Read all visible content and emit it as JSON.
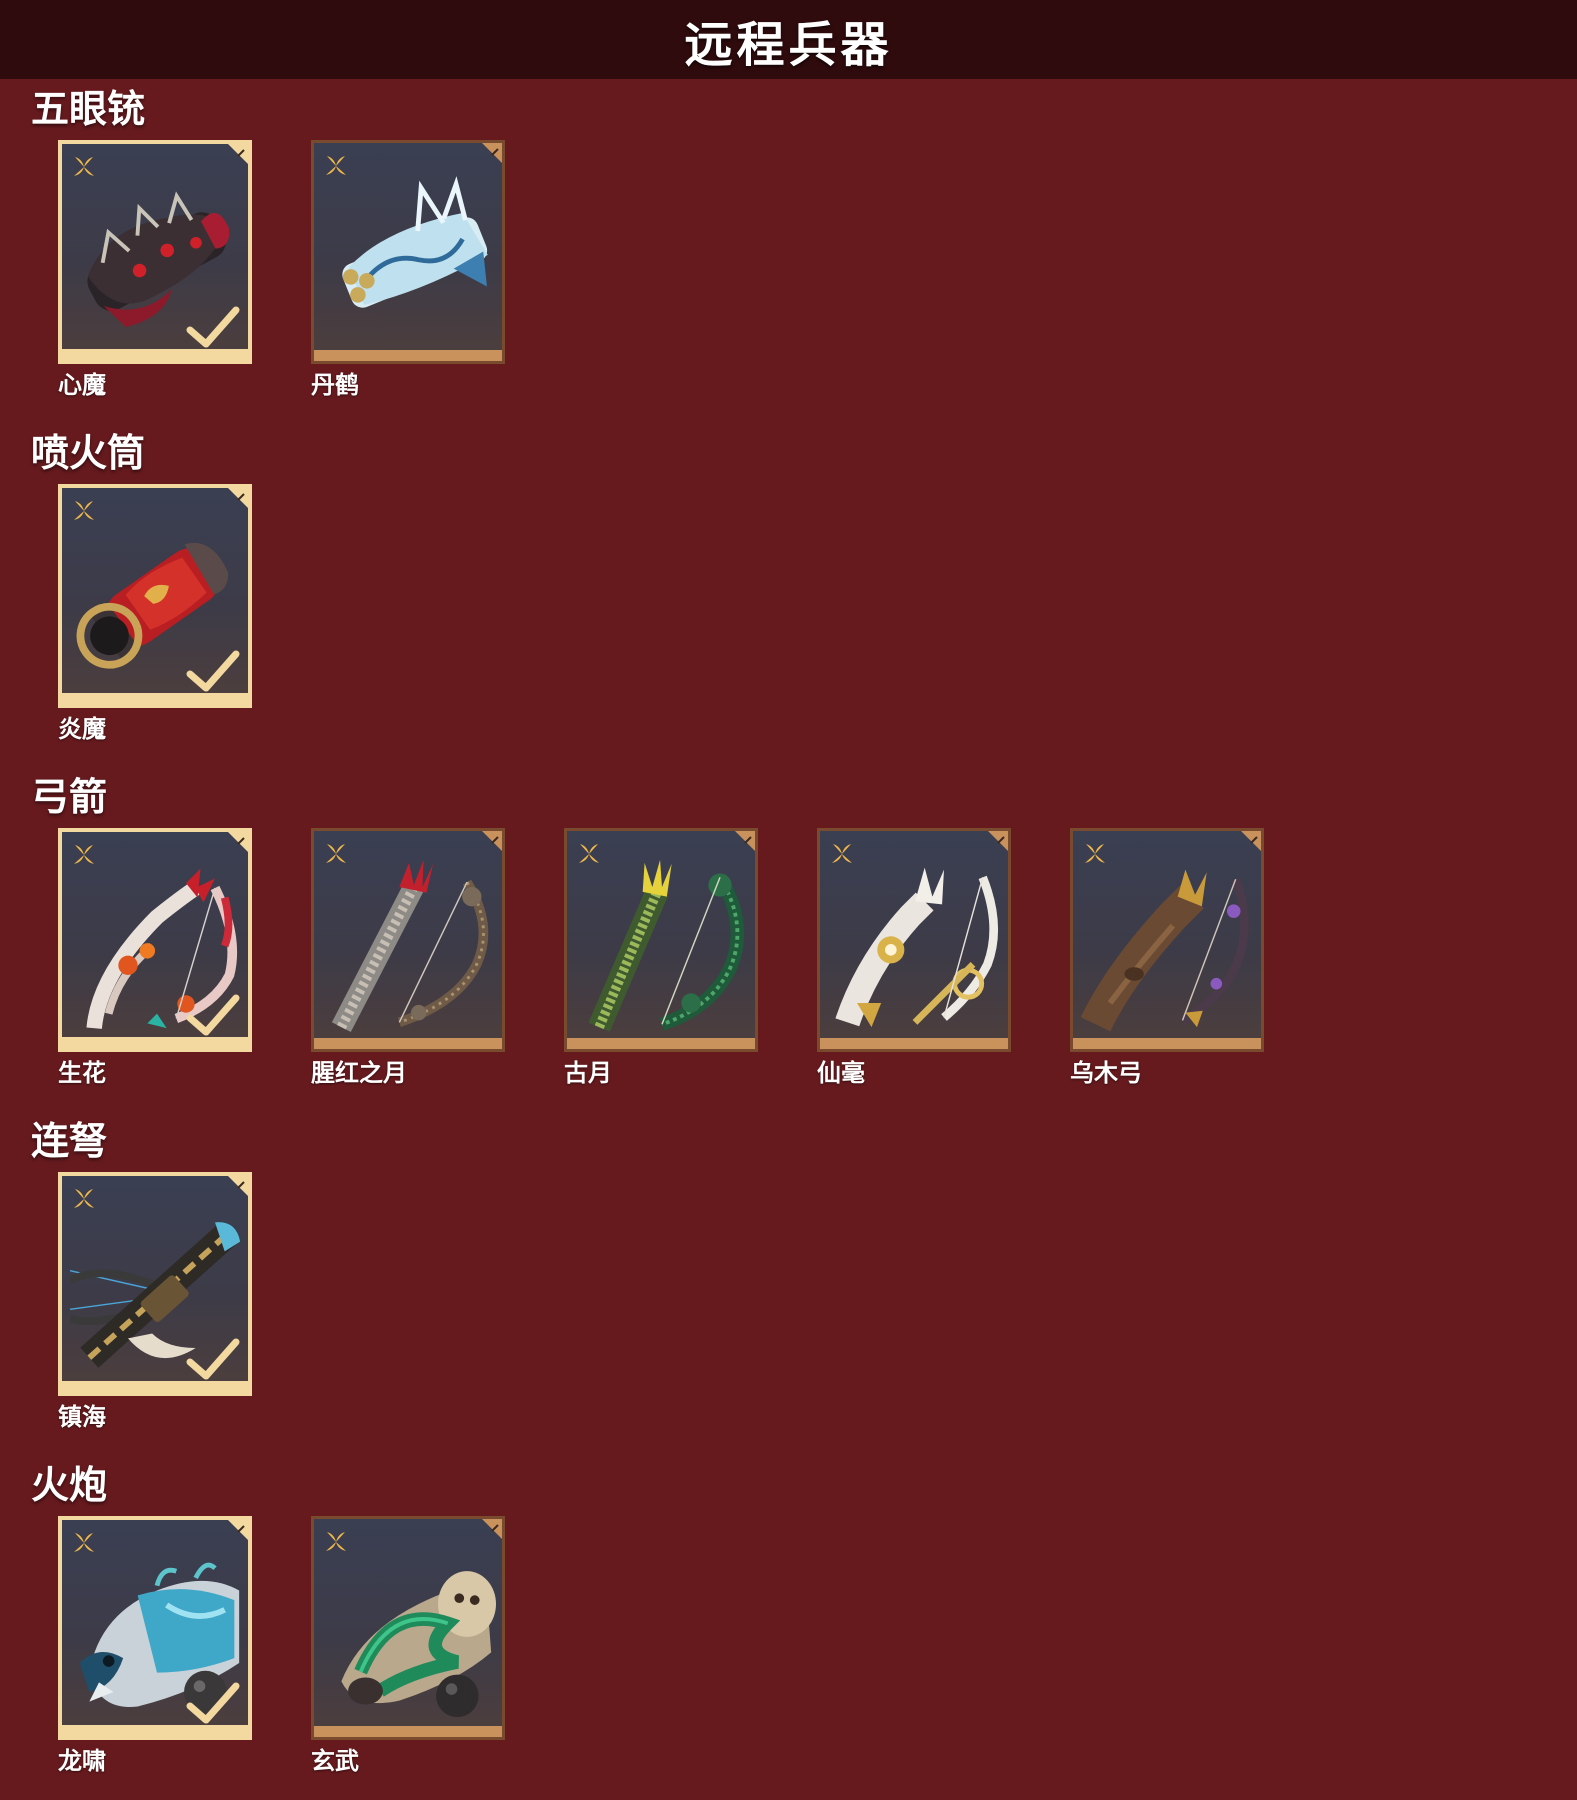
{
  "header": {
    "title": "远程兵器"
  },
  "colors": {
    "background": "#661a1e",
    "header_bg": "#2f0b0d",
    "card_frame": "#c9915c",
    "card_selected_frame": "#f3d9a0",
    "rarity_icon": "#f0b84a"
  },
  "sections": [
    {
      "title": "五眼铳",
      "items": [
        {
          "name": "心魔",
          "owned": true,
          "art": "dark-demon-gun"
        },
        {
          "name": "丹鹤",
          "owned": false,
          "art": "blue-crane-gun"
        }
      ]
    },
    {
      "title": "喷火筒",
      "items": [
        {
          "name": "炎魔",
          "owned": true,
          "art": "red-flame-tube"
        }
      ]
    },
    {
      "title": "弓箭",
      "items": [
        {
          "name": "生花",
          "owned": true,
          "art": "floral-bow"
        },
        {
          "name": "腥红之月",
          "owned": false,
          "art": "crimson-moon-bow"
        },
        {
          "name": "古月",
          "owned": false,
          "art": "jade-moon-bow"
        },
        {
          "name": "仙毫",
          "owned": false,
          "art": "white-immortal-bow"
        },
        {
          "name": "乌木弓",
          "owned": false,
          "art": "ebony-bow"
        }
      ]
    },
    {
      "title": "连弩",
      "items": [
        {
          "name": "镇海",
          "owned": true,
          "art": "sea-crossbow"
        }
      ]
    },
    {
      "title": "火炮",
      "items": [
        {
          "name": "龙啸",
          "owned": true,
          "art": "dragon-cannon"
        },
        {
          "name": "玄武",
          "owned": false,
          "art": "tortoise-cannon"
        }
      ]
    }
  ]
}
